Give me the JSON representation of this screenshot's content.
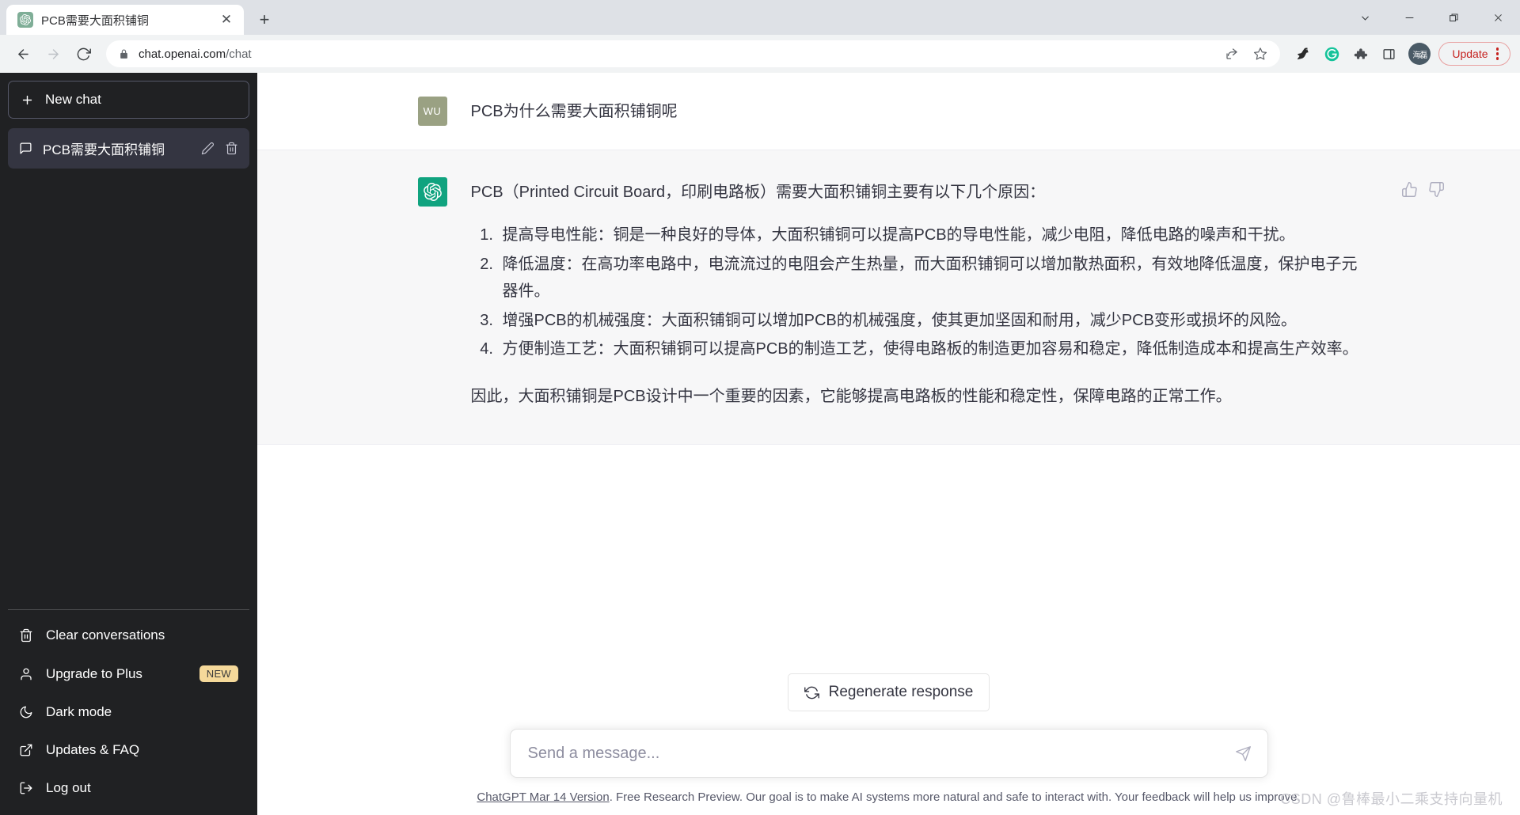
{
  "browser": {
    "tab": {
      "title": "PCB需要大面积铺铜",
      "favicon": "openai-logo-icon",
      "close_label": "✕"
    },
    "new_tab_label": "+",
    "window_controls": [
      {
        "name": "tab-search",
        "glyph": "⌄"
      },
      {
        "name": "minimize",
        "glyph": "—"
      },
      {
        "name": "maximize",
        "glyph": "❐"
      },
      {
        "name": "close",
        "glyph": "✕"
      }
    ],
    "toolbar": {
      "back": "←",
      "forward": "→",
      "reload": "⟳",
      "url_host": "chat.openai.com",
      "url_path": "/chat",
      "lock_icon": "lock-icon",
      "extensions": [
        "share-icon",
        "bookmark-star-icon",
        "bird-extension-icon",
        "grammarly-icon",
        "puzzle-extensions-icon",
        "side-panel-icon"
      ],
      "profile_avatar": "海磊",
      "update_label": "Update",
      "menu": "chrome-menu-icon"
    }
  },
  "sidebar": {
    "new_chat_label": "New chat",
    "conversations": [
      {
        "title": "PCB需要大面积铺铜",
        "active": true,
        "edit_icon": "pencil-icon",
        "delete_icon": "trash-icon"
      }
    ],
    "bottom_links": [
      {
        "label": "Clear conversations",
        "icon": "trash-icon"
      },
      {
        "label": "Upgrade to Plus",
        "icon": "person-icon",
        "badge": "NEW"
      },
      {
        "label": "Dark mode",
        "icon": "moon-icon"
      },
      {
        "label": "Updates & FAQ",
        "icon": "external-link-icon"
      },
      {
        "label": "Log out",
        "icon": "logout-icon"
      }
    ]
  },
  "chat": {
    "messages": [
      {
        "role": "user",
        "avatar_initials": "WU",
        "avatar_color": "#9aa183",
        "text": "PCB为什么需要大面积铺铜呢"
      },
      {
        "role": "assistant",
        "avatar_icon": "openai-logo-icon",
        "avatar_color": "#10a37f",
        "intro": "PCB（Printed Circuit Board，印刷电路板）需要大面积铺铜主要有以下几个原因：",
        "list": [
          "提高导电性能：铜是一种良好的导体，大面积铺铜可以提高PCB的导电性能，减少电阻，降低电路的噪声和干扰。",
          "降低温度：在高功率电路中，电流流过的电阻会产生热量，而大面积铺铜可以增加散热面积，有效地降低温度，保护电子元器件。",
          "增强PCB的机械强度：大面积铺铜可以增加PCB的机械强度，使其更加坚固和耐用，减少PCB变形或损坏的风险。",
          "方便制造工艺：大面积铺铜可以提高PCB的制造工艺，使得电路板的制造更加容易和稳定，降低制造成本和提高生产效率。"
        ],
        "closing": "因此，大面积铺铜是PCB设计中一个重要的因素，它能够提高电路板的性能和稳定性，保障电路的正常工作。",
        "thumbs_up_icon": "thumbs-up-icon",
        "thumbs_down_icon": "thumbs-down-icon"
      }
    ]
  },
  "composer": {
    "regenerate_label": "Regenerate response",
    "regenerate_icon": "refresh-icon",
    "placeholder": "Send a message...",
    "value": "",
    "send_icon": "send-icon"
  },
  "footer": {
    "version_link": "ChatGPT Mar 14 Version",
    "disclaimer": ". Free Research Preview. Our goal is to make AI systems more natural and safe to interact with. Your feedback will help us improve."
  },
  "watermark": "CSDN @鲁棒最小二乘支持向量机",
  "colors": {
    "accent": "#10a37f",
    "sidebar_bg": "#202123",
    "conversation_active_bg": "#343541",
    "assistant_bg": "#f7f7f8",
    "badge_new_bg": "#f5d99a",
    "update_red": "#c5221f"
  }
}
